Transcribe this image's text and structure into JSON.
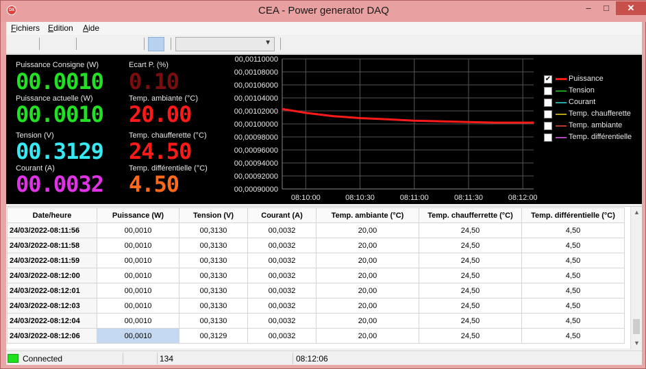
{
  "window": {
    "title": "CEA - Power generator DAQ",
    "icon_text": "DX"
  },
  "menu": [
    {
      "label_pre": "",
      "label_ul": "F",
      "label_post": "ichiers"
    },
    {
      "label_pre": "",
      "label_ul": "E",
      "label_post": "dition"
    },
    {
      "label_pre": "",
      "label_ul": "A",
      "label_post": "ide"
    }
  ],
  "meters": {
    "puissance_consigne": {
      "label": "Puissance Consigne (W)",
      "value": "00.0010"
    },
    "ecart_p": {
      "label": "Ecart P. (%)",
      "value": "0.10"
    },
    "puissance_actuelle": {
      "label": "Puissance actuelle (W)",
      "value": "00.0010"
    },
    "temp_ambiante": {
      "label": "Temp. ambiante (°C)",
      "value": "20.00"
    },
    "tension": {
      "label": "Tension (V)",
      "value": "00.3129"
    },
    "temp_chaufferette": {
      "label": "Temp. chaufferette (°C)",
      "value": "24.50"
    },
    "courant": {
      "label": "Courant (A)",
      "value": "00.0032"
    },
    "temp_differentielle": {
      "label": "Temp. différentielle (°C)",
      "value": "4.50"
    }
  },
  "chart_data": {
    "type": "line",
    "y_ticks": [
      "00,00110000",
      "00,00108000",
      "00,00106000",
      "00,00104000",
      "00,00102000",
      "00,00100000",
      "00,00098000",
      "00,00096000",
      "00,00094000",
      "00,00092000",
      "00,00090000"
    ],
    "x_ticks": [
      "08:10:00",
      "08:10:30",
      "08:11:00",
      "08:11:30",
      "08:12:00"
    ],
    "ylim": [
      0.0009,
      0.0011
    ],
    "xlim": [
      "08:09:47",
      "08:12:06"
    ],
    "grid": true,
    "legend_position": "right",
    "series": [
      {
        "name": "Puissance",
        "color": "#ff1a1a",
        "checked": true,
        "x": [
          "08:09:47",
          "08:10:00",
          "08:10:15",
          "08:10:30",
          "08:10:45",
          "08:11:00",
          "08:11:15",
          "08:11:30",
          "08:11:45",
          "08:12:00",
          "08:12:06"
        ],
        "values": [
          0.001023,
          0.001017,
          0.001012,
          0.001009,
          0.001007,
          0.001005,
          0.001004,
          0.001003,
          0.001002,
          0.001002,
          0.001002
        ]
      },
      {
        "name": "Tension",
        "color": "#1a9e1a",
        "checked": false
      },
      {
        "name": "Courant",
        "color": "#2aa8a8",
        "checked": false
      },
      {
        "name": "Temp. chaufferette",
        "color": "#b8a21a",
        "checked": false
      },
      {
        "name": "Temp. ambiante",
        "color": "#b83a1a",
        "checked": false
      },
      {
        "name": "Temp. différentielle",
        "color": "#b04ab8",
        "checked": false
      }
    ]
  },
  "table": {
    "headers": [
      "Date/heure",
      "Puissance (W)",
      "Tension (V)",
      "Courant (A)",
      "Temp. ambiante (°C)",
      "Temp. chaufferrette (°C)",
      "Temp. différentielle (°C)"
    ],
    "rows": [
      [
        "24/03/2022-08:11:56",
        "00,0010",
        "00,3130",
        "00,0032",
        "20,00",
        "24,50",
        "4,50"
      ],
      [
        "24/03/2022-08:11:58",
        "00,0010",
        "00,3130",
        "00,0032",
        "20,00",
        "24,50",
        "4,50"
      ],
      [
        "24/03/2022-08:11:59",
        "00,0010",
        "00,3130",
        "00,0032",
        "20,00",
        "24,50",
        "4,50"
      ],
      [
        "24/03/2022-08:12:00",
        "00,0010",
        "00,3130",
        "00,0032",
        "20,00",
        "24,50",
        "4,50"
      ],
      [
        "24/03/2022-08:12:01",
        "00,0010",
        "00,3130",
        "00,0032",
        "20,00",
        "24,50",
        "4,50"
      ],
      [
        "24/03/2022-08:12:03",
        "00,0010",
        "00,3130",
        "00,0032",
        "20,00",
        "24,50",
        "4,50"
      ],
      [
        "24/03/2022-08:12:04",
        "00,0010",
        "00,3130",
        "00,0032",
        "20,00",
        "24,50",
        "4,50"
      ],
      [
        "24/03/2022-08:12:06",
        "00,0010",
        "00,3129",
        "00,0032",
        "20,00",
        "24,50",
        "4,50"
      ]
    ],
    "selected_row": 7,
    "selected_col": 1
  },
  "status": {
    "connection": "Connected",
    "count": "134",
    "time": "08:12:06",
    "led_color": "#1ee01e"
  }
}
